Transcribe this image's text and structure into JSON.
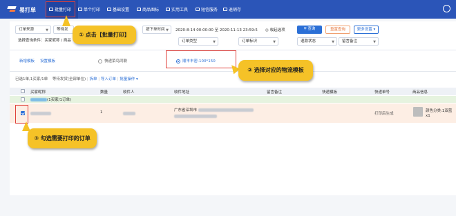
{
  "app": {
    "logo_text": "易打单"
  },
  "nav": [
    {
      "label": "批量打印",
      "icon": "printer-icon",
      "active": true
    },
    {
      "label": "单个打印",
      "icon": "printer-icon"
    },
    {
      "label": "基础设置",
      "icon": "monitor-icon"
    },
    {
      "label": "商品图标",
      "icon": "image-icon"
    },
    {
      "label": "实用工具",
      "icon": "wrench-icon"
    },
    {
      "label": "短信服务",
      "icon": "message-icon"
    },
    {
      "label": "退销存",
      "icon": "document-icon"
    }
  ],
  "filters": {
    "order_source": "订单来源",
    "wait_ship": "等待发",
    "order_time": "按下单时间",
    "date_range": "2020-8-14 00:00:00 至 2020-11-13 23:59:5",
    "collect_option": "收起选项",
    "query_button": "查询",
    "reset_button": "重置查询",
    "more_settings": "更多设置",
    "query_condition": "选择查询条件：买家昵称 / 商品",
    "order_type": "订单类型",
    "order_flag": "订单标识",
    "refund_status": "退款状态",
    "remark": "留言备注"
  },
  "template_bar": {
    "add_template": "新增模板",
    "set_template": "设置模板",
    "option_1": "快递菜鸟同联",
    "option_2": "顺丰丰密-100*150"
  },
  "summary": {
    "selected_text": "已选1单,1买家/1单",
    "wait_text": "等待发货(全部单位)",
    "split_link": "拆单",
    "import_link": "导入订单",
    "batch_link": "批量操作"
  },
  "table": {
    "headers": [
      "买家昵称",
      "数量",
      "收件人",
      "收件地址",
      "留言备注",
      "快递模板",
      "快递单号",
      "商品信息"
    ],
    "group_row": {
      "buyer_suffix": "(1买家/1订单)"
    },
    "row": {
      "qty": "1",
      "address_prefix": "广东省深圳市",
      "tracking": "打印后生成",
      "product": "颜色分类:1双蓝",
      "product_qty": "x1"
    }
  },
  "callouts": {
    "c1": "① 点击【批量打印】",
    "c2": "② 选择对应的物流模板",
    "c3": "③ 勾选需要打印的订单"
  },
  "colors": {
    "nav_bg": "#2b55b8",
    "callout_bg": "#f5c227",
    "highlight_red": "#e0413a",
    "row_highlight": "#fdeee4"
  }
}
